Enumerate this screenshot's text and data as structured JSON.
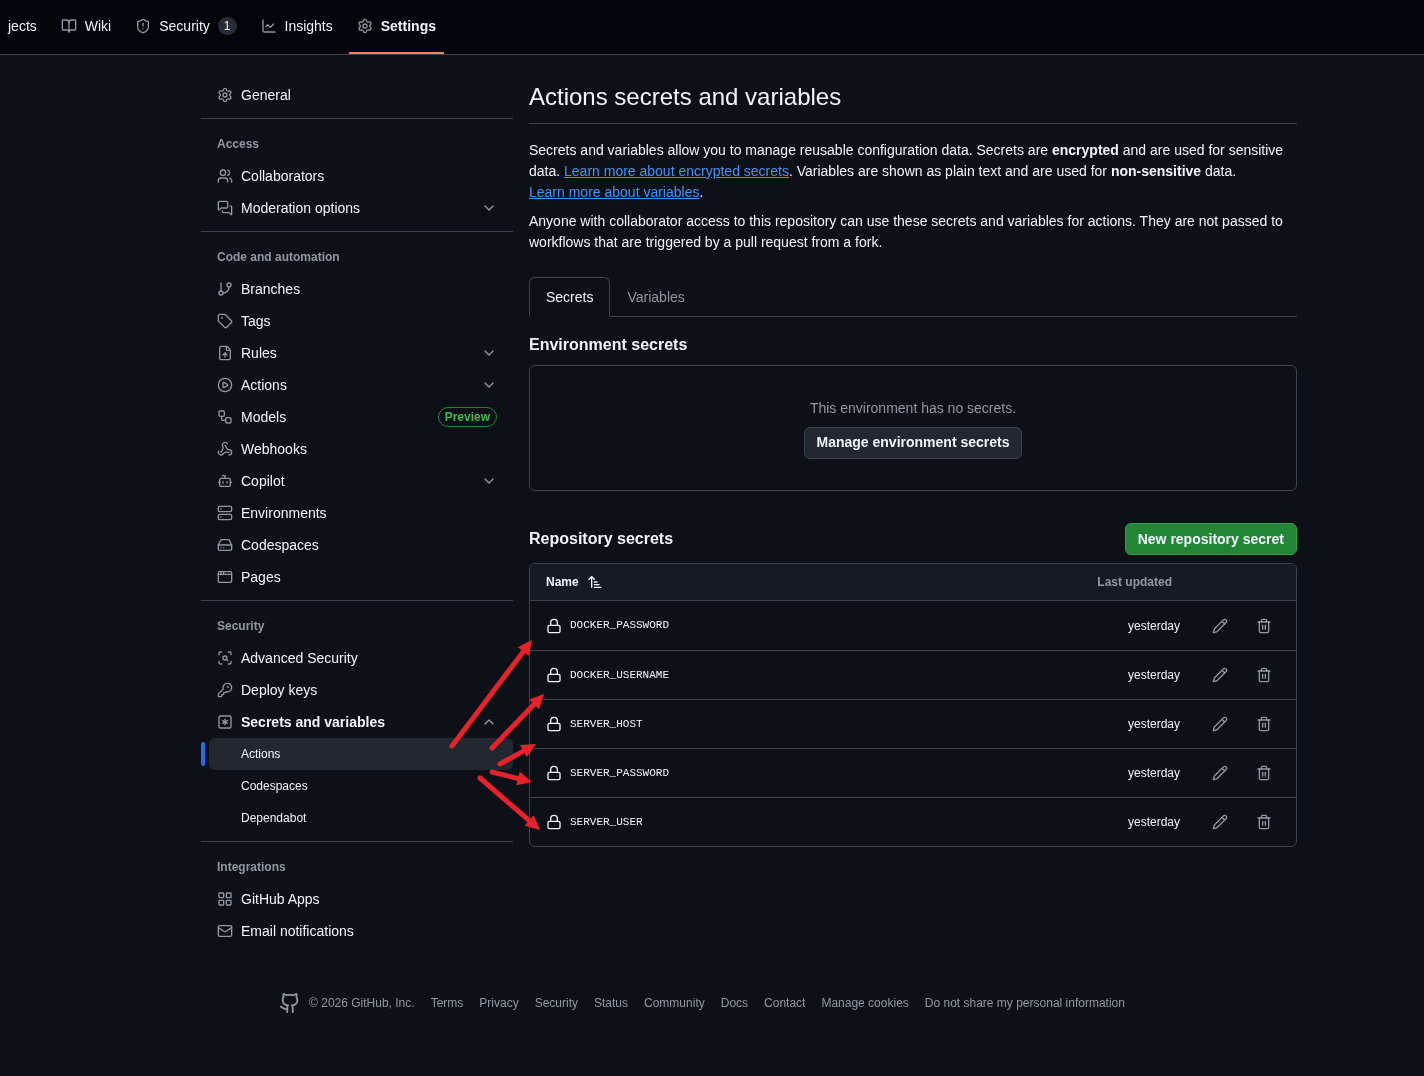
{
  "repo_nav": [
    {
      "label": "jects",
      "selected": false
    },
    {
      "label": "Wiki",
      "selected": false
    },
    {
      "label": "Security",
      "counter": "1",
      "selected": false
    },
    {
      "label": "Insights",
      "selected": false
    },
    {
      "label": "Settings",
      "selected": true
    }
  ],
  "sidebar": {
    "sections": [
      {
        "items": [
          {
            "label": "General",
            "kind": "link",
            "selected": false
          }
        ]
      },
      {
        "heading": "Access",
        "items": [
          {
            "label": "Collaborators",
            "kind": "link",
            "selected": false
          },
          {
            "label": "Moderation options",
            "kind": "menu",
            "expanded": false,
            "selected": false
          }
        ]
      },
      {
        "heading": "Code and automation",
        "items": [
          {
            "label": "Branches",
            "kind": "link",
            "selected": false
          },
          {
            "label": "Tags",
            "kind": "link",
            "selected": false
          },
          {
            "label": "Rules",
            "kind": "menu",
            "expanded": false,
            "selected": false
          },
          {
            "label": "Actions",
            "kind": "menu",
            "expanded": false,
            "selected": false
          },
          {
            "label": "Models",
            "kind": "link",
            "badge": "Preview",
            "selected": false
          },
          {
            "label": "Webhooks",
            "kind": "link",
            "selected": false
          },
          {
            "label": "Copilot",
            "kind": "menu",
            "expanded": false,
            "selected": false
          },
          {
            "label": "Environments",
            "kind": "link",
            "selected": false
          },
          {
            "label": "Codespaces",
            "kind": "link",
            "selected": false
          },
          {
            "label": "Pages",
            "kind": "link",
            "selected": false
          }
        ]
      },
      {
        "heading": "Security",
        "items": [
          {
            "label": "Advanced Security",
            "kind": "link",
            "selected": false
          },
          {
            "label": "Deploy keys",
            "kind": "link",
            "selected": false
          },
          {
            "label": "Secrets and variables",
            "kind": "menu",
            "expanded": true,
            "selected": true,
            "children": [
              {
                "label": "Actions",
                "selected": true
              },
              {
                "label": "Codespaces",
                "selected": false
              },
              {
                "label": "Dependabot",
                "selected": false
              }
            ]
          }
        ]
      },
      {
        "heading": "Integrations",
        "items": [
          {
            "label": "GitHub Apps",
            "kind": "link",
            "selected": false
          },
          {
            "label": "Email notifications",
            "kind": "link",
            "selected": false
          }
        ]
      }
    ]
  },
  "page": {
    "title": "Actions secrets and variables",
    "intro": [
      {
        "kind": "text",
        "text": "Secrets and variables allow you to manage reusable configuration data. Secrets are **encrypted** and are used for sensitive data. "
      },
      {
        "kind": "link",
        "text": "Learn more about encrypted secrets"
      },
      {
        "kind": "text",
        "text": ". Variables are shown as plain text and are used for **non-sensitive** data. "
      },
      {
        "kind": "link",
        "text": "Learn more about variables"
      },
      {
        "kind": "text",
        "text": "."
      }
    ],
    "note": "Anyone with collaborator access to this repository can use these secrets and variables for actions. They are not passed to workflows that are triggered by a pull request from a fork.",
    "tabs": [
      {
        "label": "Secrets",
        "selected": true
      },
      {
        "label": "Variables",
        "selected": false
      }
    ],
    "environment": {
      "heading": "Environment secrets",
      "empty_text": "This environment has no secrets.",
      "button": "Manage environment secrets"
    },
    "repository": {
      "heading": "Repository secrets",
      "button": "New repository secret",
      "columns": [
        "Name",
        "Last updated"
      ],
      "rows": [
        {
          "name": "DOCKER_PASSWORD",
          "updated": "yesterday"
        },
        {
          "name": "DOCKER_USERNAME",
          "updated": "yesterday"
        },
        {
          "name": "SERVER_HOST",
          "updated": "yesterday"
        },
        {
          "name": "SERVER_PASSWORD",
          "updated": "yesterday"
        },
        {
          "name": "SERVER_USER",
          "updated": "yesterday"
        }
      ]
    }
  },
  "footer": {
    "copyright": "© 2026 GitHub, Inc.",
    "links": [
      "Terms",
      "Privacy",
      "Security",
      "Status",
      "Community",
      "Docs",
      "Contact",
      "Manage cookies",
      "Do not share my personal information"
    ]
  }
}
